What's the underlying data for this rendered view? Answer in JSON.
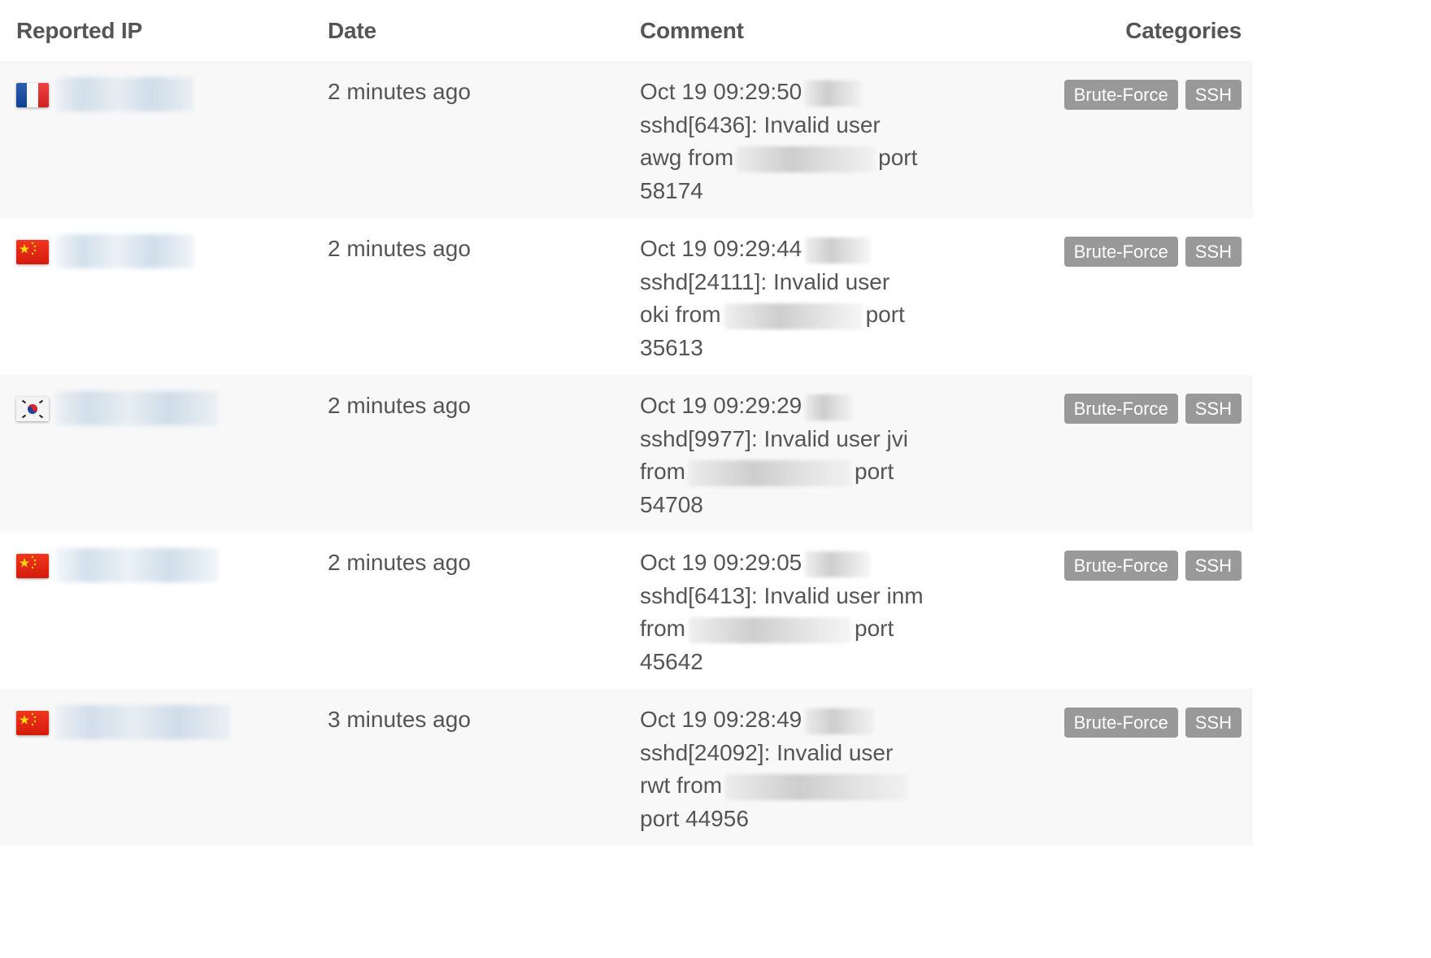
{
  "table": {
    "headers": {
      "reported_ip": "Reported IP",
      "date": "Date",
      "comment": "Comment",
      "categories": "Categories"
    },
    "rows": [
      {
        "country": "France",
        "flag_icon": "flag-france-icon",
        "ip_redacted": true,
        "date": "2 minutes ago",
        "comment": {
          "line1": "Oct 19 09:29:50",
          "line2": "sshd[6436]: Invalid user",
          "line3_pre": "awg from",
          "line3_post": "port",
          "line4": "58174"
        },
        "categories": [
          "Brute-Force",
          "SSH"
        ]
      },
      {
        "country": "China",
        "flag_icon": "flag-china-icon",
        "ip_redacted": true,
        "date": "2 minutes ago",
        "comment": {
          "line1": "Oct 19 09:29:44",
          "line2": "sshd[24111]: Invalid user",
          "line3_pre": "oki from",
          "line3_post": "port",
          "line4": "35613"
        },
        "categories": [
          "Brute-Force",
          "SSH"
        ]
      },
      {
        "country": "South Korea",
        "flag_icon": "flag-south-korea-icon",
        "ip_redacted": true,
        "date": "2 minutes ago",
        "comment": {
          "line1": "Oct 19 09:29:29",
          "line2": "sshd[9977]: Invalid user jvi",
          "line3_pre": "from",
          "line3_post": "port",
          "line4": "54708"
        },
        "categories": [
          "Brute-Force",
          "SSH"
        ]
      },
      {
        "country": "China",
        "flag_icon": "flag-china-icon",
        "ip_redacted": true,
        "date": "2 minutes ago",
        "comment": {
          "line1": "Oct 19 09:29:05",
          "line2": "sshd[6413]: Invalid user inm",
          "line3_pre": "from",
          "line3_post": "port",
          "line4": "45642"
        },
        "categories": [
          "Brute-Force",
          "SSH"
        ]
      },
      {
        "country": "China",
        "flag_icon": "flag-china-icon",
        "ip_redacted": true,
        "date": "3 minutes ago",
        "comment": {
          "line1": "Oct 19 09:28:49",
          "line2": "sshd[24092]: Invalid user",
          "line3_pre": "rwt from",
          "line3_post": "",
          "line4": "port 44956"
        },
        "categories": [
          "Brute-Force",
          "SSH"
        ]
      }
    ]
  },
  "colors": {
    "text": "#555555",
    "tag_bg": "#999999",
    "tag_text": "#ffffff",
    "row_stripe": "#f8f8f8"
  }
}
